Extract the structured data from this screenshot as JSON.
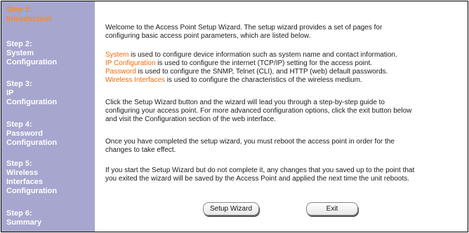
{
  "sidebar": {
    "steps": [
      {
        "line1": "Step 1:",
        "line2": "Introduction",
        "active": true
      },
      {
        "line1": "Step 2:",
        "line2": "System",
        "line3": "Configuration"
      },
      {
        "line1": "Step 3:",
        "line2": "IP",
        "line3": "Configuration"
      },
      {
        "line1": "Step 4:",
        "line2": "Password",
        "line3": "Configuration"
      },
      {
        "line1": "Step 5:",
        "line2": "Wireless",
        "line3": "Interfaces",
        "line4": "Configuration"
      },
      {
        "line1": "Step 6:",
        "line2": "Summary"
      }
    ]
  },
  "main": {
    "intro": [
      "Welcome to the Access Point Setup Wizard. The setup wizard provides a set of pages for",
      "configuring basic access point parameters, which are listed below."
    ],
    "items": [
      {
        "term": "System",
        "text": " is used to configure device information such as system name and contact information."
      },
      {
        "term": "IP Configuration",
        "text": " is used to configure the internet (TCP/IP) setting for the access point."
      },
      {
        "term": "Password",
        "text": " is used to configure the SNMP, Telnet (CLI), and HTTP (web) default passwords."
      },
      {
        "term": "Wireless Interfaces",
        "text": " is used to configure the characteristics of the wireless medium."
      }
    ],
    "guide": [
      "Click the Setup Wizard button and the wizard will lead you through a step-by-step guide to",
      "configuring your access point. For more advanced configuration options, click the exit button below",
      "and visit the Configuration section of the web interface."
    ],
    "reboot": [
      "Once you have completed the setup wizard, you must reboot the access point in order for the",
      "changes to take effect."
    ],
    "incomplete": [
      "If you start the Setup Wizard but do not complete it, any changes that you saved up to the point that",
      "you exited the wizard will be saved by the Access Point and applied the next time the unit reboots."
    ],
    "buttons": {
      "setup": "Setup Wizard",
      "exit": "Exit"
    }
  },
  "colors": {
    "sidebar": "#a6a6cf",
    "accent": "#ff6600",
    "active_step": "#ff8a1a"
  }
}
